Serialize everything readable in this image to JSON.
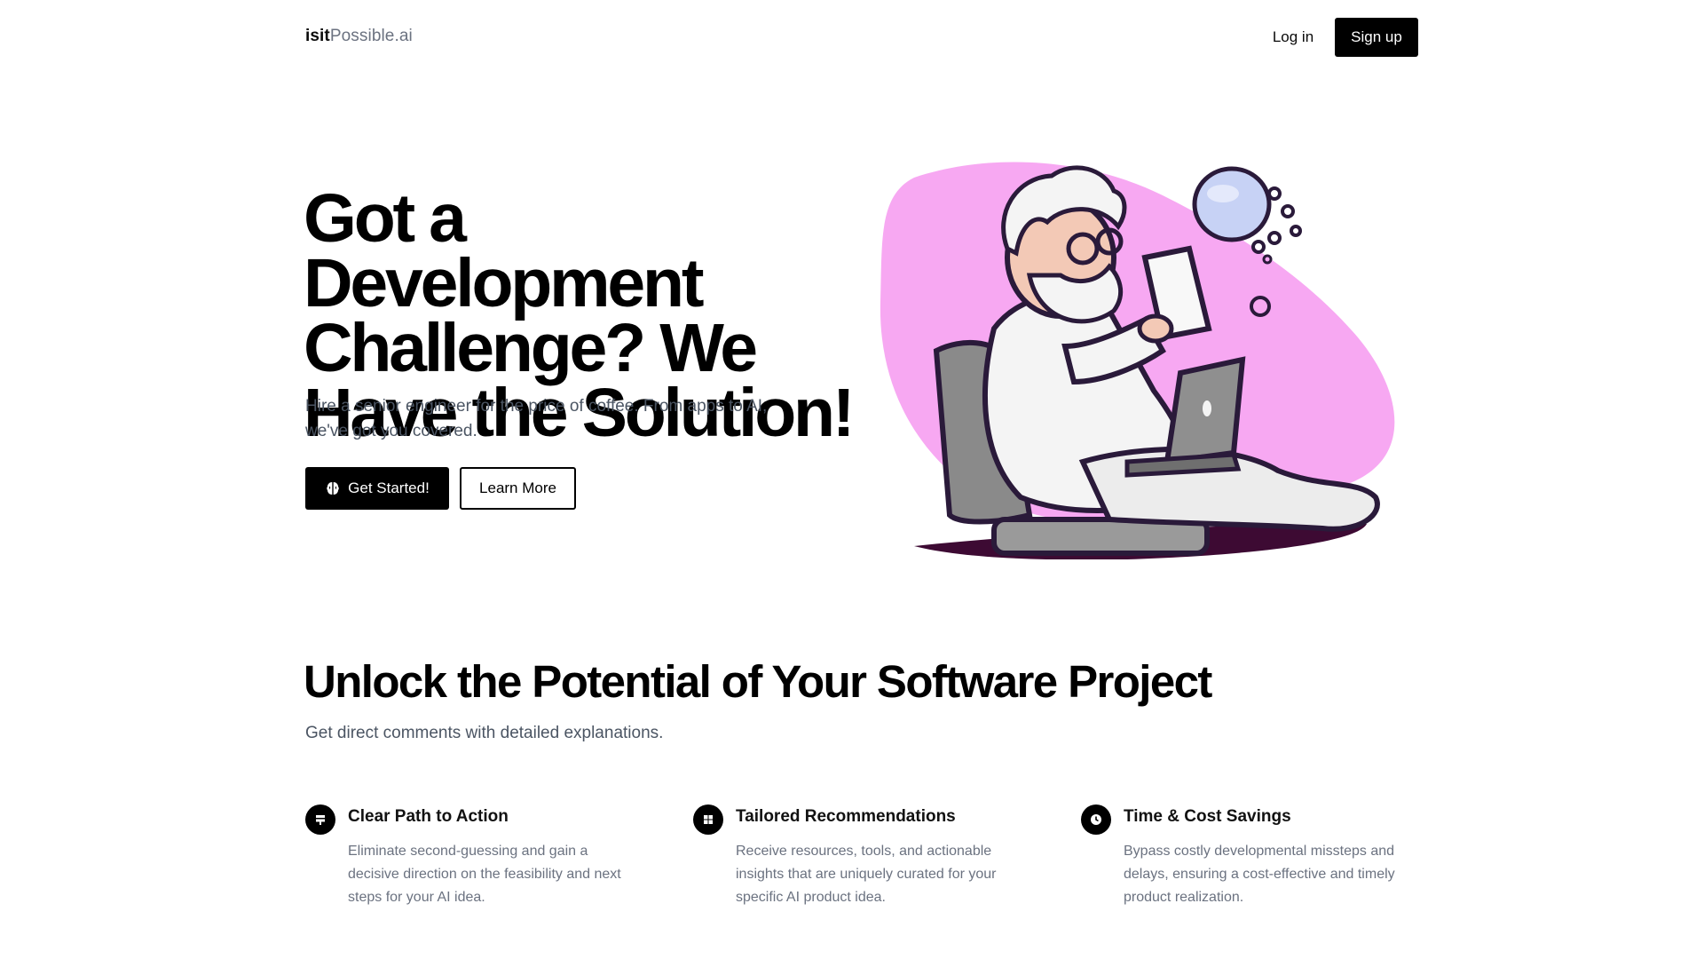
{
  "nav": {
    "logo_bold": "isit",
    "logo_light": "Possible.ai",
    "login_label": "Log in",
    "signup_label": "Sign up"
  },
  "hero": {
    "title": "Got a Development Challenge? We Have the Solution!",
    "subtitle": "Hire a senior engineer for the price of coffee. From apps to AI, we've got you covered.",
    "primary_button": "Get Started!",
    "secondary_button": "Learn More",
    "primary_icon": "brain-icon",
    "illustration": "scientist-with-laptop-illustration"
  },
  "section": {
    "title": "Unlock the Potential of Your Software Project",
    "subtitle": "Get direct comments with detailed explanations."
  },
  "features": [
    {
      "icon": "signpost-icon",
      "title": "Clear Path to Action",
      "description": "Eliminate second-guessing and gain a decisive direction on the feasibility and next steps for your AI idea."
    },
    {
      "icon": "grid-icon",
      "title": "Tailored Recommendations",
      "description": "Receive resources, tools, and actionable insights that are uniquely curated for your specific AI product idea."
    },
    {
      "icon": "clock-icon",
      "title": "Time & Cost Savings",
      "description": "Bypass costly developmental missteps and delays, ensuring a cost-effective and timely product realization."
    }
  ],
  "colors": {
    "accent": "#000000",
    "text_muted": "#6b7280",
    "blob_pink": "#f7a8f2"
  }
}
